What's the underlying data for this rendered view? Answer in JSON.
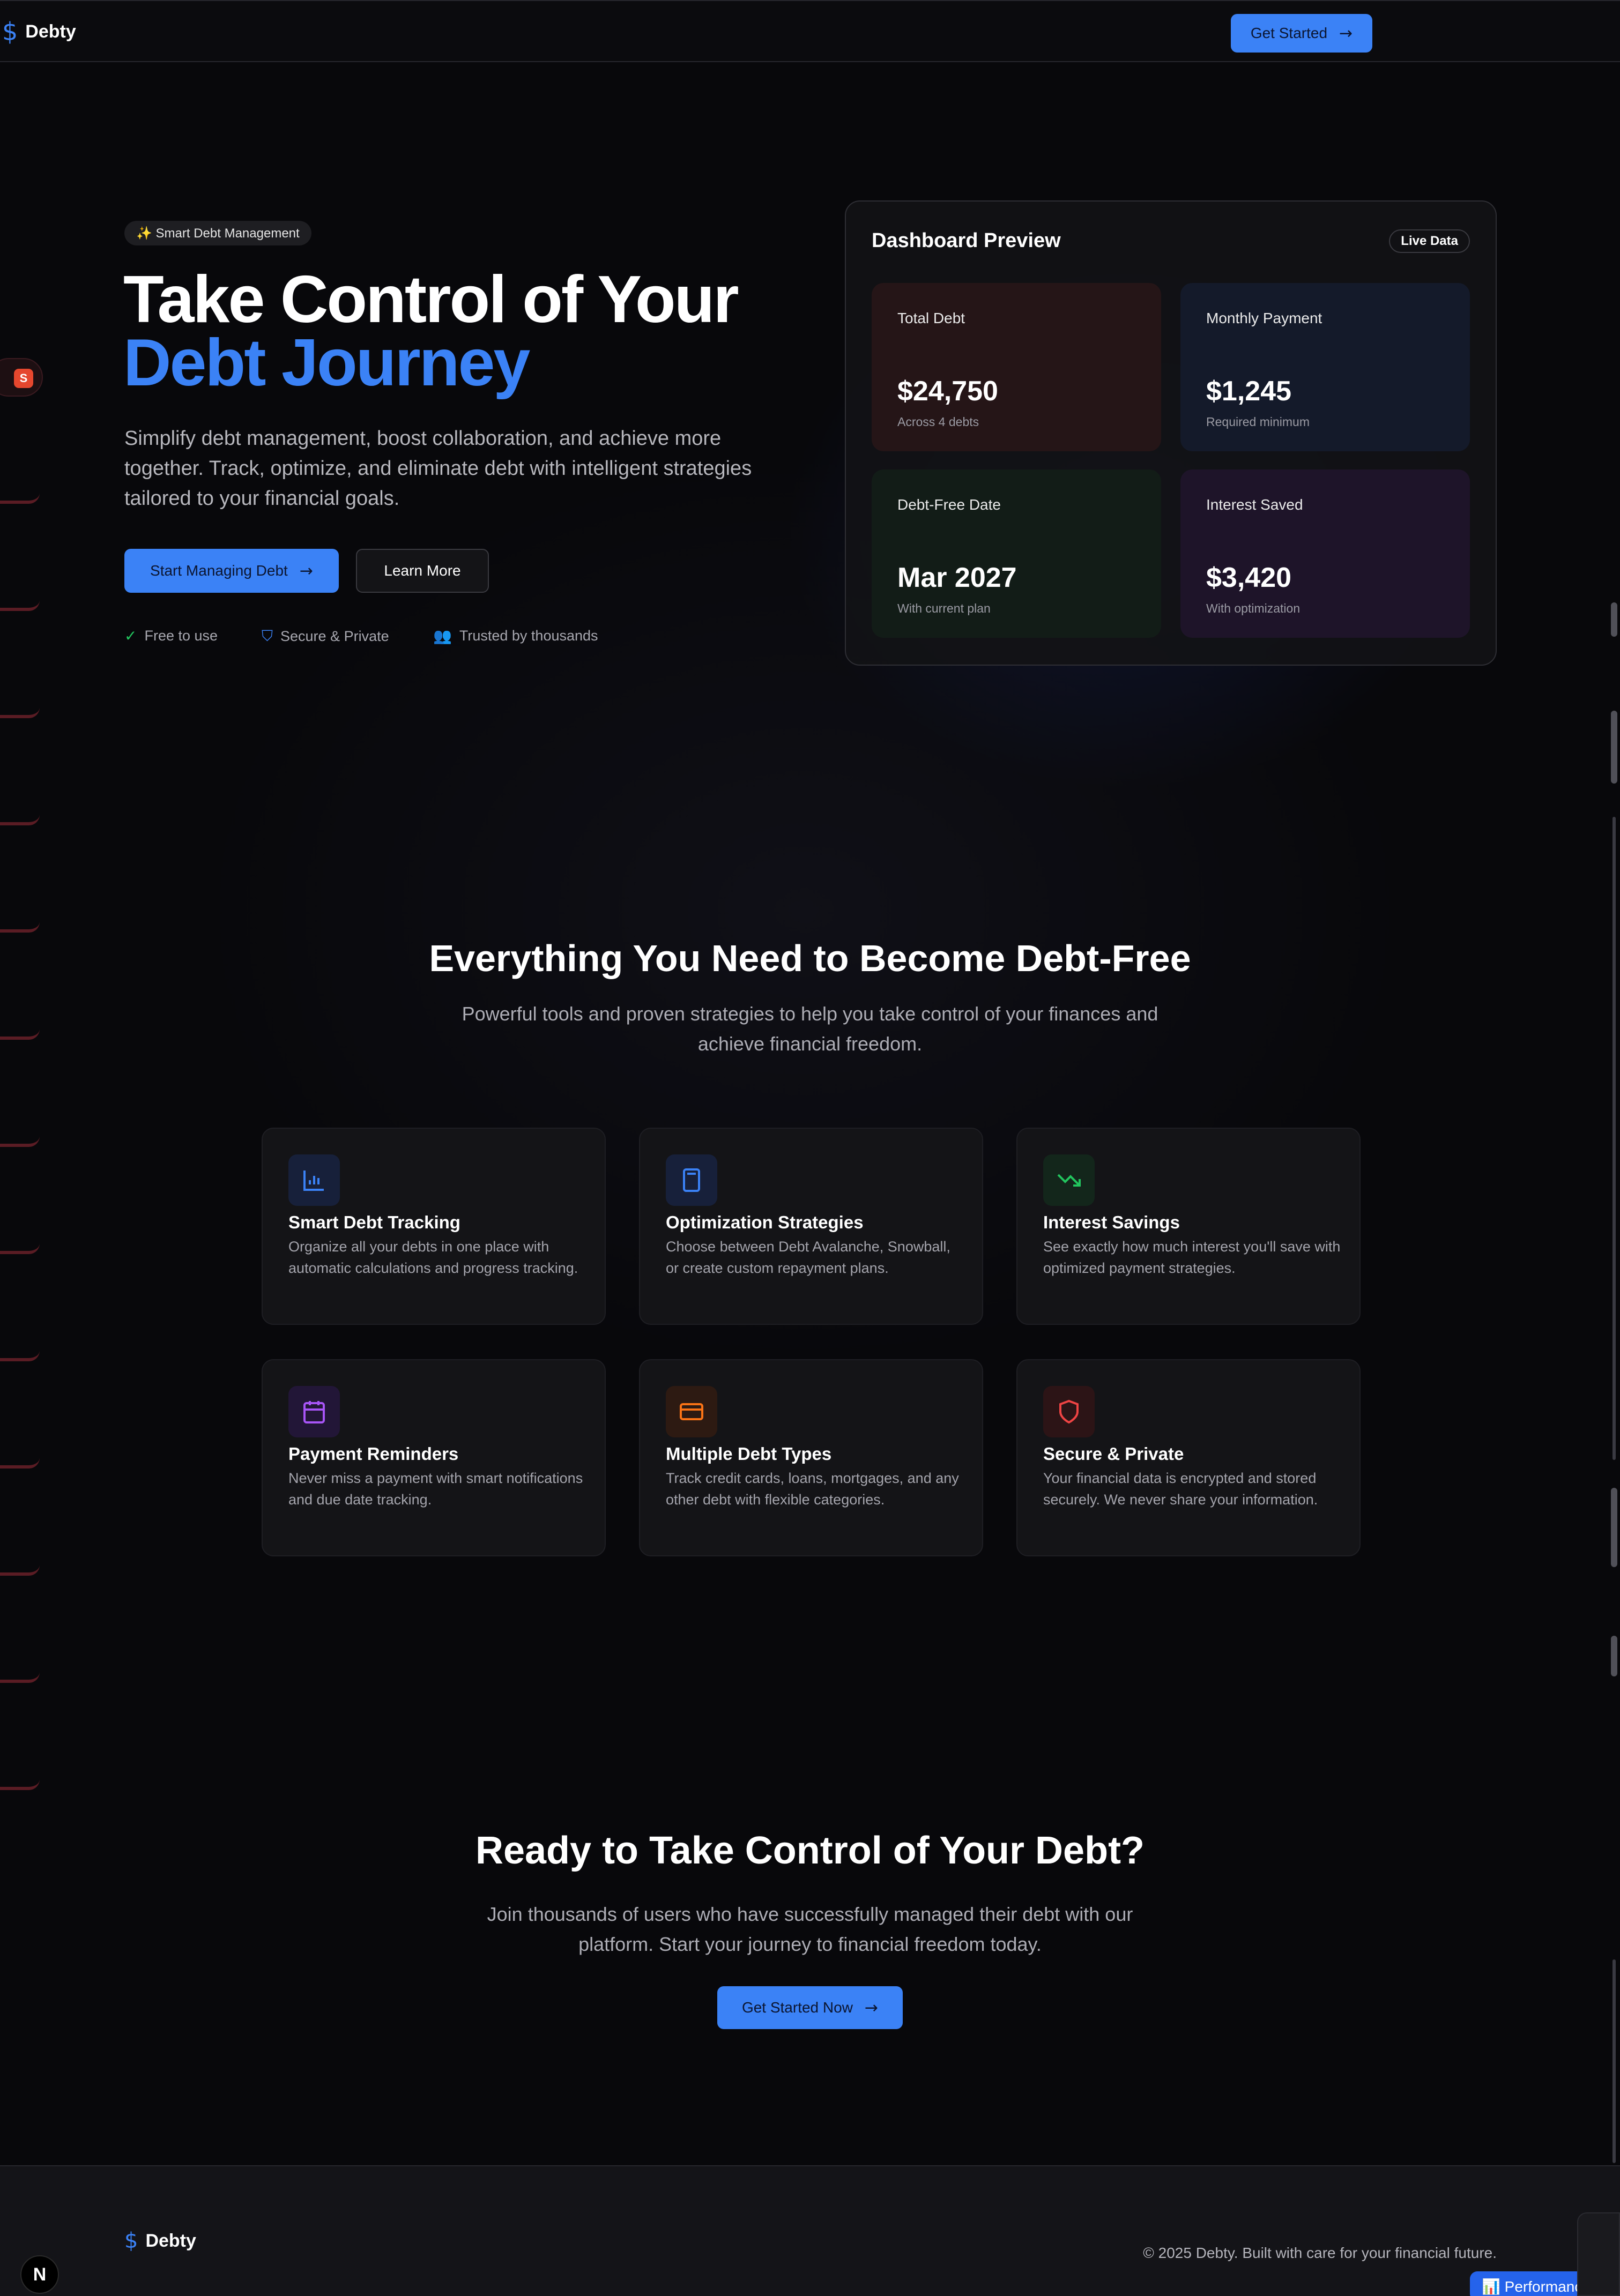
{
  "header": {
    "logo_text": "Debty",
    "cta_label": "Get Started"
  },
  "hero": {
    "badge": "✨ Smart Debt Management",
    "title_line1": "Take Control of Your",
    "title_line2": "Debt Journey",
    "subtitle": "Simplify debt management, boost collaboration, and achieve more together. Track, optimize, and eliminate debt with intelligent strategies tailored to your financial goals.",
    "primary_cta": "Start Managing Debt",
    "secondary_cta": "Learn More",
    "trust": [
      {
        "label": "Free to use",
        "icon": "check-circle-icon",
        "color": "#22c55e"
      },
      {
        "label": "Secure & Private",
        "icon": "shield-icon",
        "color": "#3b82f6"
      },
      {
        "label": "Trusted by thousands",
        "icon": "users-icon",
        "color": "#a855f7"
      }
    ]
  },
  "dashboard": {
    "title": "Dashboard Preview",
    "badge": "Live Data",
    "stats": [
      {
        "label": "Total Debt",
        "value": "$24,750",
        "note": "Across 4 debts",
        "bg": "#251517"
      },
      {
        "label": "Monthly Payment",
        "value": "$1,245",
        "note": "Required minimum",
        "bg": "#141a2a"
      },
      {
        "label": "Debt-Free Date",
        "value": "Mar 2027",
        "note": "With current plan",
        "bg": "#121c17"
      },
      {
        "label": "Interest Saved",
        "value": "$3,420",
        "note": "With optimization",
        "bg": "#1e1429"
      }
    ]
  },
  "features": {
    "title": "Everything You Need to Become Debt-Free",
    "subtitle": "Powerful tools and proven strategies to help you take control of your finances and achieve financial freedom.",
    "items": [
      {
        "title": "Smart Debt Tracking",
        "desc": "Organize all your debts in one place with automatic calculations and progress tracking.",
        "icon": "bar-chart-icon",
        "color": "#3b82f6",
        "bg": "#17203a"
      },
      {
        "title": "Optimization Strategies",
        "desc": "Choose between Debt Avalanche, Snowball, or create custom repayment plans.",
        "icon": "calculator-icon",
        "color": "#3b82f6",
        "bg": "#17203a"
      },
      {
        "title": "Interest Savings",
        "desc": "See exactly how much interest you'll save with optimized payment strategies.",
        "icon": "trending-down-icon",
        "color": "#22c55e",
        "bg": "#13261b"
      },
      {
        "title": "Payment Reminders",
        "desc": "Never miss a payment with smart notifications and due date tracking.",
        "icon": "calendar-icon",
        "color": "#a855f7",
        "bg": "#221637"
      },
      {
        "title": "Multiple Debt Types",
        "desc": "Track credit cards, loans, mortgages, and any other debt with flexible categories.",
        "icon": "credit-card-icon",
        "color": "#f97316",
        "bg": "#2d1a12"
      },
      {
        "title": "Secure & Private",
        "desc": "Your financial data is encrypted and stored securely. We never share your information.",
        "icon": "shield-icon",
        "color": "#ef4444",
        "bg": "#2c1416"
      }
    ]
  },
  "cta": {
    "title": "Ready to Take Control of Your Debt?",
    "subtitle": "Join thousands of users who have successfully managed their debt with our platform. Start your journey to financial freedom today.",
    "button": "Get Started Now"
  },
  "footer": {
    "logo_text": "Debty",
    "copyright": "© 2025 Debty. Built with care for your financial future.",
    "n_badge": "N",
    "perf_label": "📊 Performance"
  },
  "edge": {
    "tab_letter": "S"
  },
  "colors": {
    "accent": "#3b82f6",
    "background": "#08080b"
  }
}
